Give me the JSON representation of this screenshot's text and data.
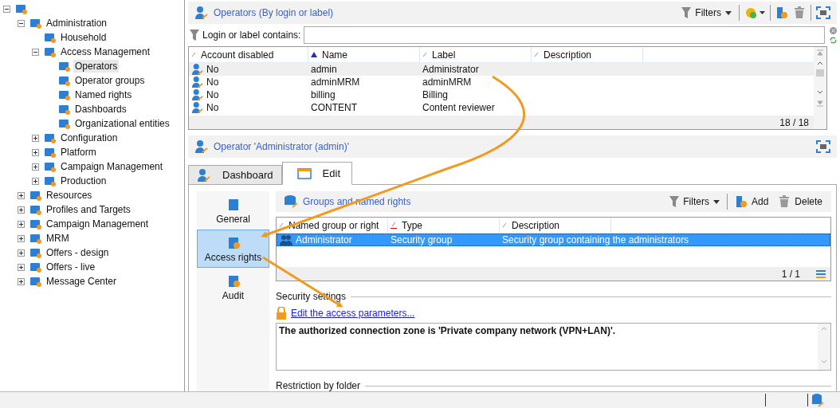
{
  "tree": [
    {
      "expanded": true,
      "children": [
        {
          "label": "Administration",
          "expanded": true,
          "selected": false,
          "children": [
            {
              "label": "Household",
              "selected": false
            },
            {
              "label": "Access Management",
              "expanded": true,
              "selected": false,
              "children": [
                {
                  "label": "Operators",
                  "selected": true
                },
                {
                  "label": "Operator groups",
                  "selected": false
                },
                {
                  "label": "Named rights",
                  "selected": false
                },
                {
                  "label": "Dashboards",
                  "selected": false
                },
                {
                  "label": "Organizational entities",
                  "selected": false
                }
              ]
            },
            {
              "label": "Configuration",
              "expanded": false,
              "selected": false
            },
            {
              "label": "Platform",
              "expanded": false,
              "selected": false
            },
            {
              "label": "Campaign Management",
              "expanded": false,
              "selected": false
            },
            {
              "label": "Production",
              "expanded": false,
              "selected": false
            }
          ]
        },
        {
          "label": "Resources",
          "expanded": false,
          "selected": false
        },
        {
          "label": "Profiles and Targets",
          "expanded": false,
          "selected": false
        },
        {
          "label": "Campaign Management",
          "expanded": false,
          "selected": false
        },
        {
          "label": "MRM",
          "expanded": false,
          "selected": false
        },
        {
          "label": "Offers - design",
          "expanded": false,
          "selected": false
        },
        {
          "label": "Offers - live",
          "expanded": false,
          "selected": false
        },
        {
          "label": "Message Center",
          "expanded": false,
          "selected": false
        }
      ]
    }
  ],
  "operators": {
    "title": "Operators (By login or label)",
    "filters": "Filters",
    "search_label": "Login or label contains:",
    "columns": [
      {
        "label": "Account disabled",
        "sorted": false
      },
      {
        "label": "Name",
        "sorted": true
      },
      {
        "label": "Label",
        "sorted": false
      },
      {
        "label": "Description",
        "sorted": false
      }
    ],
    "rows": [
      {
        "cells": [
          "No",
          "admin",
          "Administrator"
        ],
        "selected": true
      },
      {
        "cells": [
          "No",
          "adminMRM",
          "adminMRM"
        ],
        "selected": false
      },
      {
        "cells": [
          "No",
          "billing",
          "Billing"
        ],
        "selected": false
      },
      {
        "cells": [
          "No",
          "CONTENT",
          "Content reviewer"
        ],
        "selected": false
      }
    ],
    "count": "18 / 18"
  },
  "detail": {
    "title": "Operator 'Administrator (admin)'",
    "tabs": [
      {
        "label": "Dashboard",
        "selected": false
      },
      {
        "label": "Edit",
        "selected": true
      }
    ],
    "nav": [
      {
        "label": "General",
        "selected": false
      },
      {
        "label": "Access rights",
        "selected": true
      },
      {
        "label": "Audit",
        "selected": false
      }
    ],
    "groups": {
      "title": "Groups and named rights",
      "buttons": [
        "Filters",
        "Add",
        "Delete"
      ],
      "columns": [
        {
          "label": "Named group or right",
          "highlighted": false
        },
        {
          "label": "Type",
          "highlighted": true
        },
        {
          "label": "Description",
          "highlighted": false
        }
      ],
      "rows": [
        {
          "cells": [
            "Administrator",
            "Security group",
            "Security group containing the administrators"
          ],
          "selected": true
        }
      ],
      "count": "1 / 1"
    },
    "security_heading": "Security settings",
    "link": "Edit the access parameters...",
    "zone_text": "The authorized connection zone is 'Private company network (VPN+LAN)'.",
    "restriction_heading": "Restriction by folder"
  }
}
